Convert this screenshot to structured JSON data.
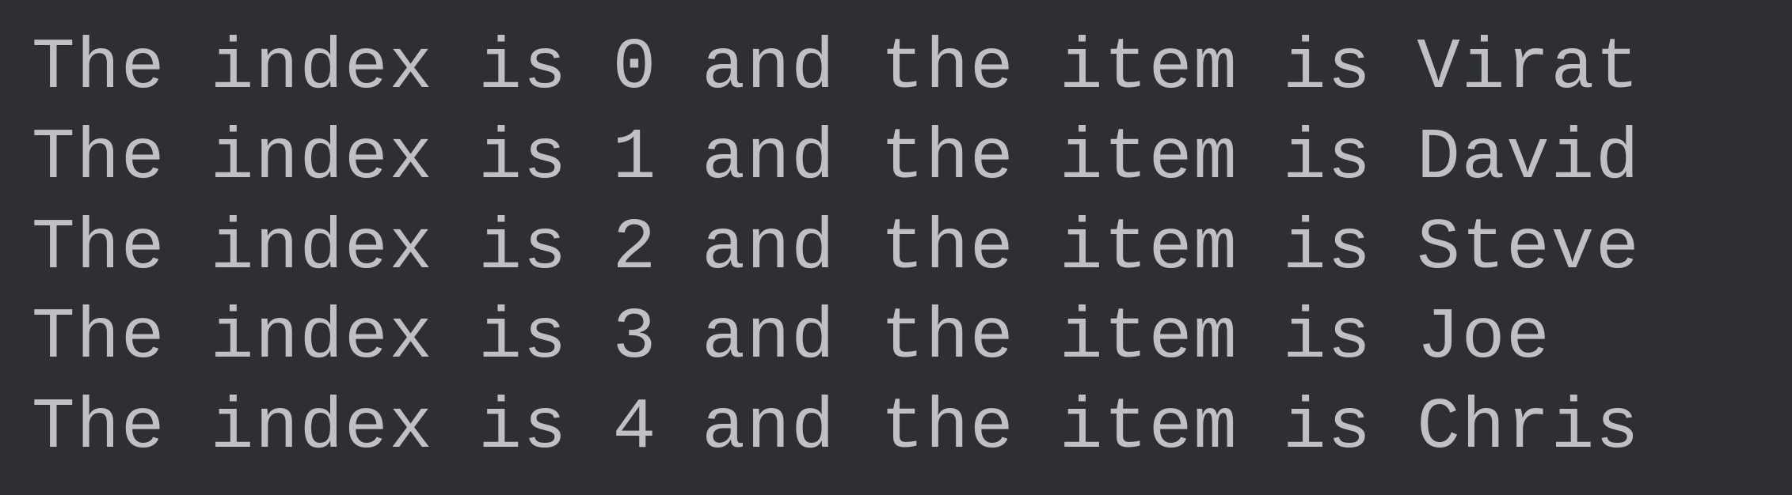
{
  "output": {
    "lines": [
      "The index is 0 and the item is Virat",
      "The index is 1 and the item is David",
      "The index is 2 and the item is Steve",
      "The index is 3 and the item is Joe",
      "The index is 4 and the item is Chris"
    ]
  }
}
